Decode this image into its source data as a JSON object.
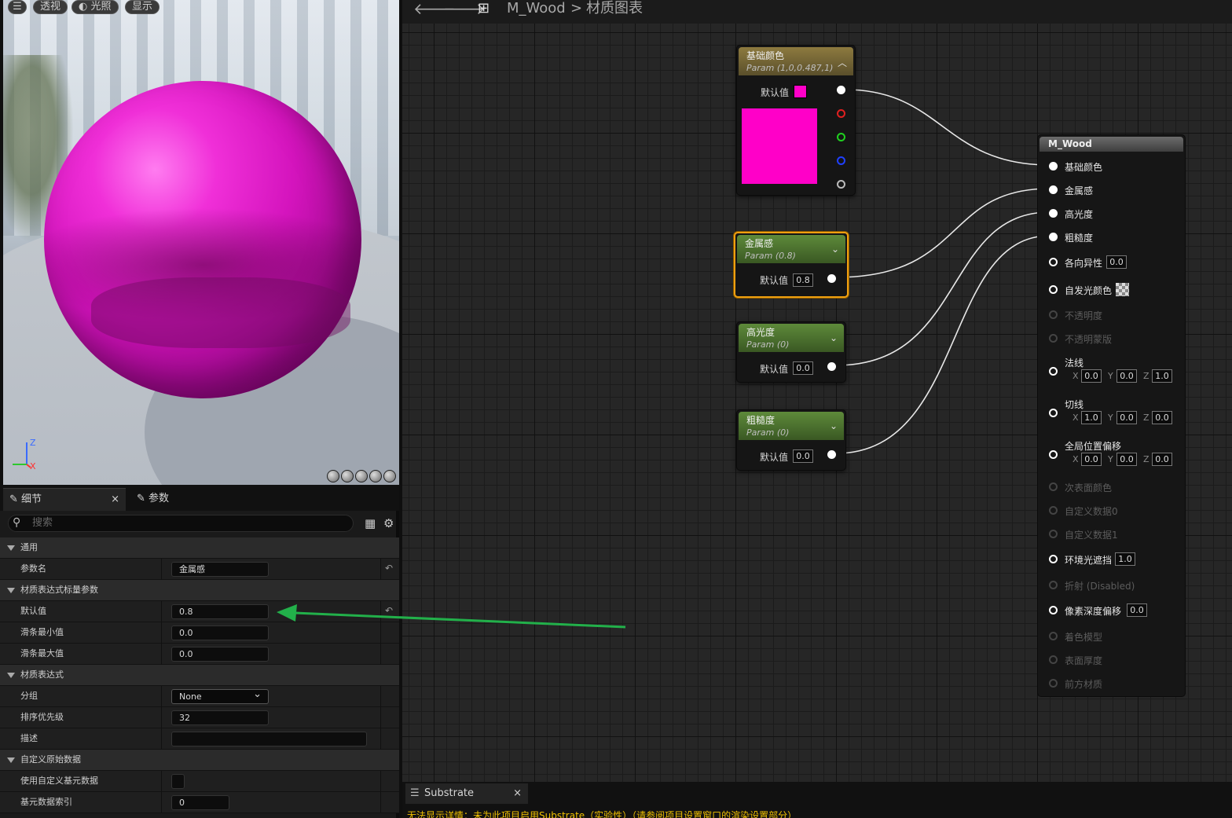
{
  "viewport": {
    "buttons": [
      "透视",
      "光照",
      "显示"
    ],
    "axis_z": "Z",
    "axis_x": "X"
  },
  "details": {
    "tab_details": "细节",
    "tab_params": "参数",
    "search_placeholder": "搜索",
    "rows": [
      {
        "kind": "cat",
        "label": "通用"
      },
      {
        "kind": "prop",
        "label": "参数名",
        "value": "金属感",
        "reset": true
      },
      {
        "kind": "cat",
        "label": "材质表达式标量参数"
      },
      {
        "kind": "prop",
        "label": "默认值",
        "value": "0.8",
        "reset": true
      },
      {
        "kind": "prop",
        "label": "滑条最小值",
        "value": "0.0"
      },
      {
        "kind": "prop",
        "label": "滑条最大值",
        "value": "0.0"
      },
      {
        "kind": "cat",
        "label": "材质表达式"
      },
      {
        "kind": "prop",
        "label": "分组",
        "value": "None"
      },
      {
        "kind": "prop",
        "label": "排序优先级",
        "value": "32"
      },
      {
        "kind": "prop",
        "label": "描述",
        "value": ""
      },
      {
        "kind": "cat",
        "label": "自定义原始数据"
      },
      {
        "kind": "prop",
        "label": "使用自定义基元数据",
        "value": ""
      },
      {
        "kind": "prop",
        "label": "基元数据索引",
        "value": "0"
      }
    ]
  },
  "graph": {
    "breadcrumb_asset": "M_Wood",
    "breadcrumb_sep": ">",
    "breadcrumb_graph": "材质图表",
    "node_base_color": {
      "title": "基础颜色",
      "subtitle": "Param (1,0,0.487,1)",
      "default_label": "默认值",
      "swatch_color": "#ff00c8"
    },
    "node_metallic": {
      "title": "金属感",
      "subtitle": "Param (0.8)",
      "default_label": "默认值",
      "value": "0.8"
    },
    "node_specular": {
      "title": "高光度",
      "subtitle": "Param (0)",
      "default_label": "默认值",
      "value": "0.0"
    },
    "node_roughness": {
      "title": "粗糙度",
      "subtitle": "Param (0)",
      "default_label": "默认值",
      "value": "0.0"
    },
    "output": {
      "title": "M_Wood",
      "pins": {
        "base_color": "基础颜色",
        "metallic": "金属感",
        "specular": "高光度",
        "roughness": "粗糙度",
        "anisotropy": "各向异性",
        "anisotropy_val": "0.0",
        "emissive": "自发光颜色",
        "opacity": "不透明度",
        "opacity_mask": "不透明蒙版",
        "normal": "法线",
        "normal_x": "0.0",
        "normal_y": "0.0",
        "normal_z": "1.0",
        "tangent": "切线",
        "tangent_x": "1.0",
        "tangent_y": "0.0",
        "tangent_z": "0.0",
        "wpo": "全局位置偏移",
        "wpo_x": "0.0",
        "wpo_y": "0.0",
        "wpo_z": "0.0",
        "subsurface": "次表面颜色",
        "custom0": "自定义数据0",
        "custom1": "自定义数据1",
        "ao": "环境光遮挡",
        "ao_val": "1.0",
        "refraction": "折射 (Disabled)",
        "pdo": "像素深度偏移",
        "pdo_val": "0.0",
        "shading_model": "着色模型",
        "surface_thickness": "表面厚度",
        "front_material": "前方材质"
      }
    }
  },
  "substrate": {
    "tab": "Substrate",
    "message": "无法显示详情：未为此项目启用Substrate（实验性）（请参阅项目设置窗口的渲染设置部分）"
  },
  "colors": {
    "accent_selected": "#f0a010",
    "annotation_arrow": "#22b04a",
    "param_header": "#5e8a3a",
    "swatch": "#ff00c8"
  }
}
